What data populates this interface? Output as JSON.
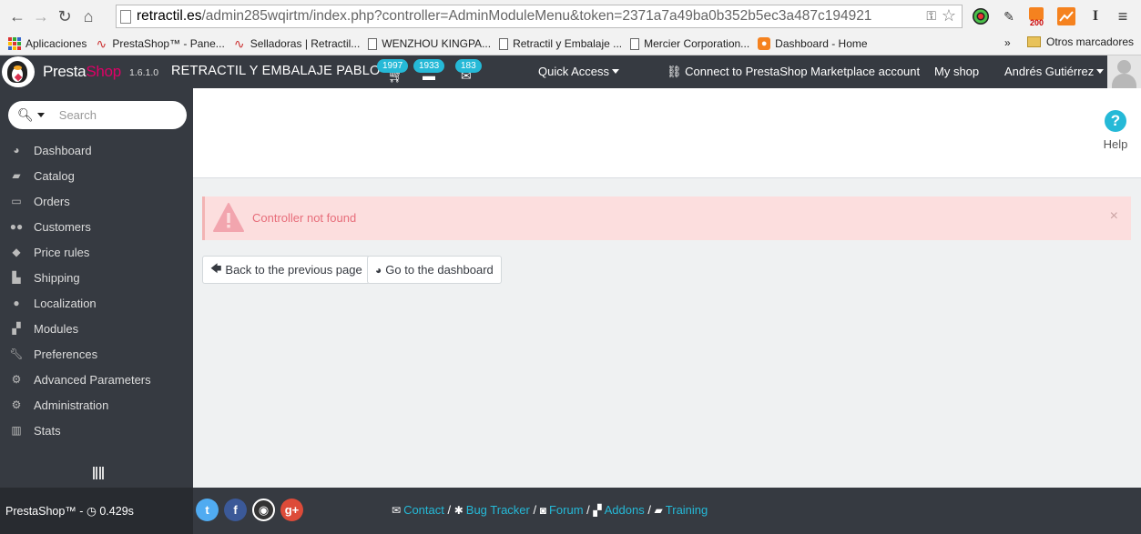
{
  "browser": {
    "url_host": "retractil.es",
    "url_path": "/admin285wqirtm/index.php?controller=AdminModuleMenu&token=2371a7a49ba0b352b5ec3a487c194921",
    "rss_count": "200",
    "bookmarks": [
      {
        "label": "Aplicaciones",
        "icon": "apps-icon"
      },
      {
        "label": "PrestaShop™ - Pane...",
        "icon": "wave-icon"
      },
      {
        "label": "Selladoras | Retractil...",
        "icon": "wave-icon"
      },
      {
        "label": "WENZHOU KINGPA...",
        "icon": "page-icon"
      },
      {
        "label": "Retractil y Embalaje ...",
        "icon": "page-icon"
      },
      {
        "label": "Mercier Corporation...",
        "icon": "page-icon"
      },
      {
        "label": "Dashboard - Home",
        "icon": "orange-icon"
      }
    ],
    "more": "»",
    "other_bookmarks": "Otros marcadores"
  },
  "header": {
    "brand_presta": "Presta",
    "brand_shop": "Shop",
    "version": "1.6.1.0",
    "shop_name": "RETRACTIL Y EMBALAJE PABLO",
    "notifications": [
      {
        "icon": "cart-icon",
        "count": "1997"
      },
      {
        "icon": "customer-icon",
        "count": "1933"
      },
      {
        "icon": "message-icon",
        "count": "183"
      }
    ],
    "quick_access": "Quick Access",
    "marketplace": "Connect to PrestaShop Marketplace account",
    "my_shop": "My shop",
    "user": "Andrés Gutiérrez"
  },
  "sidebar": {
    "search_placeholder": "Search",
    "items": [
      {
        "label": "Dashboard",
        "icon": "dashboard-icon"
      },
      {
        "label": "Catalog",
        "icon": "book-icon"
      },
      {
        "label": "Orders",
        "icon": "credit-card-icon"
      },
      {
        "label": "Customers",
        "icon": "users-icon"
      },
      {
        "label": "Price rules",
        "icon": "tags-icon"
      },
      {
        "label": "Shipping",
        "icon": "truck-icon"
      },
      {
        "label": "Localization",
        "icon": "globe-icon"
      },
      {
        "label": "Modules",
        "icon": "puzzle-icon"
      },
      {
        "label": "Preferences",
        "icon": "wrench-icon"
      },
      {
        "label": "Advanced Parameters",
        "icon": "cogs-icon"
      },
      {
        "label": "Administration",
        "icon": "cog-icon"
      },
      {
        "label": "Stats",
        "icon": "bar-chart-icon"
      }
    ]
  },
  "main": {
    "help_label": "Help",
    "alert_text": "Controller not found",
    "alert_close": "×",
    "back_button": "Back to the previous page",
    "dashboard_button": "Go to the dashboard"
  },
  "footer": {
    "version_label": "PrestaShop™ - ",
    "load_time": "0.429s",
    "links": [
      {
        "label": "Contact",
        "icon": "envelope-icon"
      },
      {
        "label": "Bug Tracker",
        "icon": "bug-icon"
      },
      {
        "label": "Forum",
        "icon": "comments-icon"
      },
      {
        "label": "Addons",
        "icon": "puzzle-icon"
      },
      {
        "label": "Training",
        "icon": "book-icon"
      }
    ],
    "separator": " / "
  },
  "colors": {
    "dark": "#363a41",
    "accent": "#25b9d7",
    "brand_pink": "#df0067",
    "alert_bg": "#fcdede",
    "alert_text": "#e76d7a"
  }
}
